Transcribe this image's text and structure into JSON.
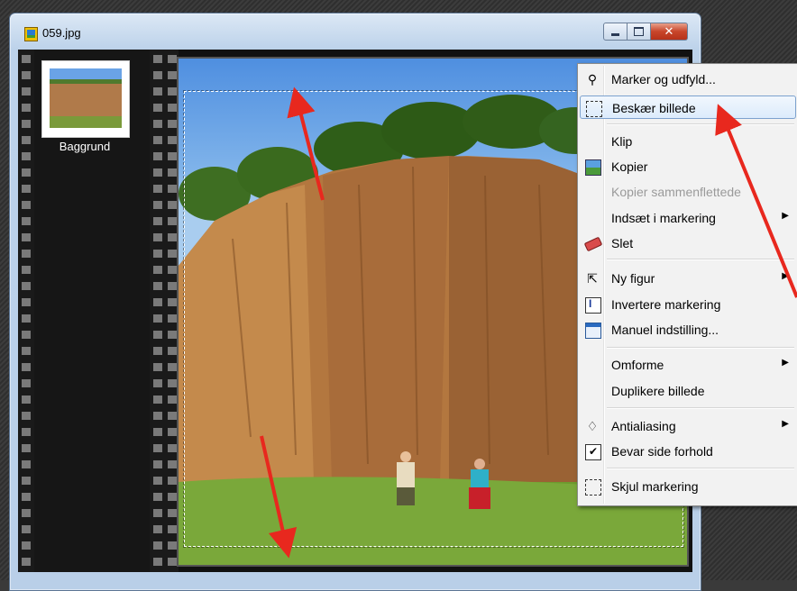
{
  "window": {
    "title": "059.jpg",
    "icon": "image-file-icon"
  },
  "layers": [
    {
      "label": "Baggrund"
    }
  ],
  "context_menu": {
    "items": [
      {
        "label": "Marker og udfyld...",
        "icon": "lasso-fill-icon"
      },
      {
        "label": "Beskær billede",
        "icon": "crop-icon",
        "highlighted": true
      },
      {
        "label": "Klip"
      },
      {
        "label": "Kopier",
        "icon": "copy-image-icon"
      },
      {
        "label": "Kopier sammenflettede",
        "disabled": true
      },
      {
        "label": "Indsæt i markering",
        "submenu": true
      },
      {
        "label": "Slet",
        "icon": "eraser-icon"
      },
      {
        "label": "Ny figur",
        "icon": "pointer-icon",
        "submenu": true
      },
      {
        "label": "Invertere markering",
        "icon": "invert-selection-icon"
      },
      {
        "label": "Manuel indstilling...",
        "icon": "dialog-icon"
      },
      {
        "label": "Omforme",
        "submenu": true
      },
      {
        "label": "Duplikere billede"
      },
      {
        "label": "Antialiasing",
        "icon": "drop-icon",
        "submenu": true
      },
      {
        "label": "Bevar side forhold",
        "icon": "checkbox-icon",
        "checked": true
      },
      {
        "label": "Skjul markering",
        "icon": "hide-selection-icon"
      }
    ]
  },
  "colors": {
    "arrow": "#e8281e",
    "highlight_border": "#7da2ce",
    "close_button": "#c8452a"
  }
}
